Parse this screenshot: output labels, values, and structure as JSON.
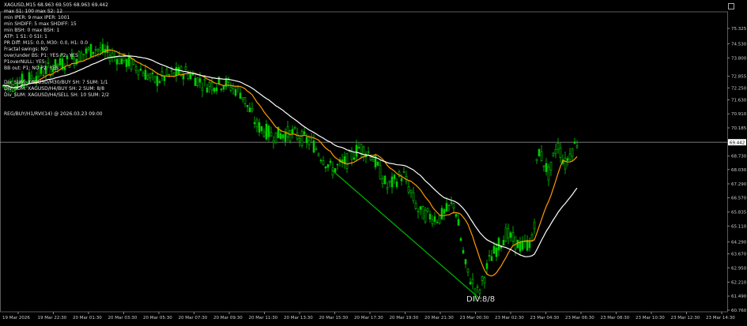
{
  "window": {
    "title": "XAGUSD,M15  68.963 69.505 68.963 69.442"
  },
  "info_lines": [
    "max S1: 100  max S2: 12",
    "min IPER: 9  max IPER: 1001",
    "min SHDIFF: 5  max SHDIFF: 15",
    "min BSH: 0  max BSH: 1",
    "ATP: 1  S1: 0  S1I: 1",
    "PR Diff: M15: 0.0,  M30: 0.0,  H1: 0.0",
    "Fractal swings: NO",
    "over/under BS: P1: YES  P2: YES",
    "P1overNULL: YES",
    "BB out: P1: NO  P2: YES"
  ],
  "signal_lines": [
    "Div_SUM: XAGUSD/M30/BUY  SH: 7  SUM: 1/1",
    "Div_SUM: XAGUSD/H4/BUY  SH: 2  SUM: 8/8",
    "Div_SUM: XAGUSD/H4/SELL  SH: 10  SUM: 2/2"
  ],
  "reg_line": "REG/BUY/H1/RVI(14) @ 2026.03.23 09:00",
  "div_label": "DIV:8/8",
  "current_price": "69.442",
  "price_axis": [
    "75.325",
    "74.530",
    "73.800",
    "72.855",
    "72.250",
    "71.630",
    "70.910",
    "70.185",
    "69.442",
    "68.730",
    "68.030",
    "67.290",
    "66.570",
    "65.835",
    "65.110",
    "64.290",
    "63.670",
    "62.950",
    "62.210",
    "61.490",
    "60.760"
  ],
  "time_axis": [
    "19 Mar 2026",
    "19 Mar 22:30",
    "20 Mar 01:30",
    "20 Mar 03:30",
    "20 Mar 05:30",
    "20 Mar 07:30",
    "20 Mar 09:30",
    "20 Mar 11:30",
    "20 Mar 13:30",
    "20 Mar 15:30",
    "20 Mar 17:30",
    "20 Mar 19:30",
    "20 Mar 21:30",
    "23 Mar 00:30",
    "23 Mar 02:30",
    "23 Mar 04:30",
    "23 Mar 06:30",
    "23 Mar 08:30",
    "23 Mar 10:30",
    "23 Mar 12:30",
    "23 Mar 14:30"
  ],
  "colors": {
    "background": "#000000",
    "candle": "#00cc00",
    "ma_fast": "#ff9900",
    "ma_slow": "#ffffff",
    "trend_line": "#00aa00",
    "axis_text": "#cccccc",
    "price_line": "#888888"
  },
  "price_range": {
    "min": 60.76,
    "max": 75.325
  }
}
